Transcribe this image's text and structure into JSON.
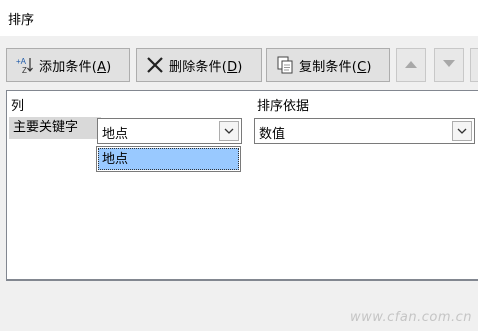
{
  "window": {
    "title": "排序"
  },
  "toolbar": {
    "add_label": "添加条件(",
    "add_key": "A",
    "add_tail": ")",
    "delete_label": "删除条件(",
    "delete_key": "D",
    "delete_tail": ")",
    "copy_label": "复制条件(",
    "copy_key": "C",
    "copy_tail": ")"
  },
  "grid": {
    "col_header_column": "列",
    "col_header_sort_on": "排序依据",
    "row_label": "主要关键字",
    "column_value": "地点",
    "sort_on_value": "数值"
  },
  "dropdown": {
    "options": [
      "地点"
    ],
    "selected_index": 0
  },
  "watermark": "www.cfan.com.cn",
  "colors": {
    "highlight": "#99c9ff",
    "rowlabel_bg": "#d9d9d9"
  },
  "icons": [
    "sort-az-icon",
    "delete-x-icon",
    "copy-icon",
    "move-up-icon",
    "move-down-icon",
    "chevron-down-icon"
  ]
}
